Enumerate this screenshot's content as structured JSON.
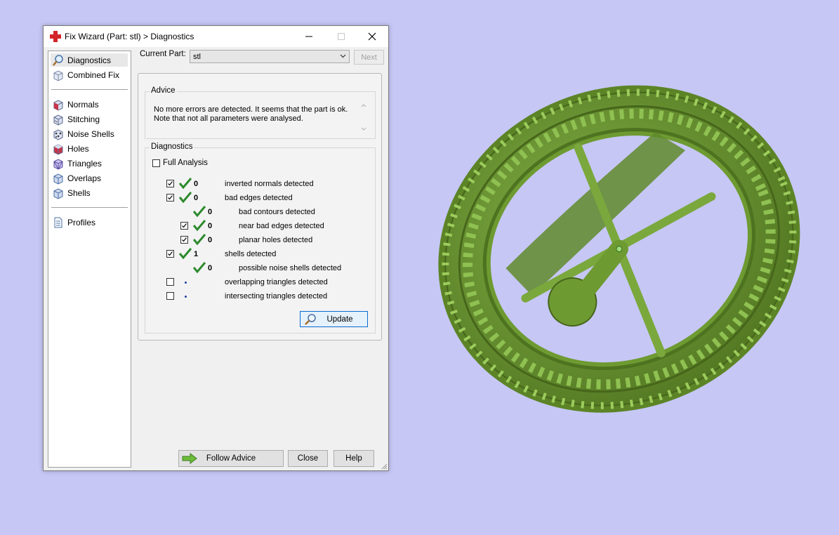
{
  "window": {
    "title": "Fix Wizard (Part: stl) > Diagnostics",
    "controls": {
      "minimize": "minimize-icon",
      "maximize": "maximize-icon",
      "close": "close-icon"
    }
  },
  "sidebar": {
    "group1": [
      {
        "label": "Diagnostics",
        "icon": "magnifier-icon",
        "selected": true
      },
      {
        "label": "Combined Fix",
        "icon": "cube-icon"
      }
    ],
    "group2": [
      {
        "label": "Normals",
        "icon": "normals-cube-icon"
      },
      {
        "label": "Stitching",
        "icon": "stitching-cube-icon"
      },
      {
        "label": "Noise Shells",
        "icon": "noise-shells-icon"
      },
      {
        "label": "Holes",
        "icon": "holes-cube-icon"
      },
      {
        "label": "Triangles",
        "icon": "triangles-cube-icon"
      },
      {
        "label": "Overlaps",
        "icon": "overlaps-cube-icon"
      },
      {
        "label": "Shells",
        "icon": "shells-cube-icon"
      }
    ],
    "group3": [
      {
        "label": "Profiles",
        "icon": "document-icon"
      }
    ]
  },
  "current_part": {
    "label": "Current Part:",
    "value": "stl",
    "next_label": "Next"
  },
  "advice": {
    "title": "Advice",
    "line1": "No more errors are detected. It seems that the part is ok.",
    "line2": "Note that not all parameters were analysed."
  },
  "diagnostics": {
    "title": "Diagnostics",
    "full_analysis_label": "Full Analysis",
    "rows": [
      {
        "checkbox": true,
        "checked": true,
        "status": "ok",
        "count": "0",
        "label": "inverted normals detected"
      },
      {
        "checkbox": true,
        "checked": true,
        "status": "ok",
        "count": "0",
        "label": "bad edges detected"
      },
      {
        "checkbox": false,
        "status": "ok",
        "count": "0",
        "label": "bad contours detected"
      },
      {
        "checkbox": true,
        "checked": true,
        "status": "ok",
        "count": "0",
        "label": "near bad edges detected"
      },
      {
        "checkbox": true,
        "checked": true,
        "status": "ok",
        "count": "0",
        "label": "planar holes detected"
      },
      {
        "checkbox": true,
        "checked": true,
        "status": "ok",
        "count": "1",
        "label": "shells detected"
      },
      {
        "checkbox": false,
        "status": "ok",
        "count": "0",
        "label": "possible noise shells detected"
      },
      {
        "checkbox": true,
        "checked": false,
        "status": "not-analysed",
        "count": "",
        "label": "overlapping triangles detected"
      },
      {
        "checkbox": true,
        "checked": false,
        "status": "not-analysed",
        "count": "",
        "label": "intersecting triangles detected"
      }
    ],
    "update_label": "Update"
  },
  "buttons": {
    "follow_advice": "Follow Advice",
    "close": "Close",
    "help": "Help"
  },
  "viewport": {
    "model": "green-tire-3d-model",
    "color": "#6e9a32",
    "background": "#c6c7f5"
  }
}
